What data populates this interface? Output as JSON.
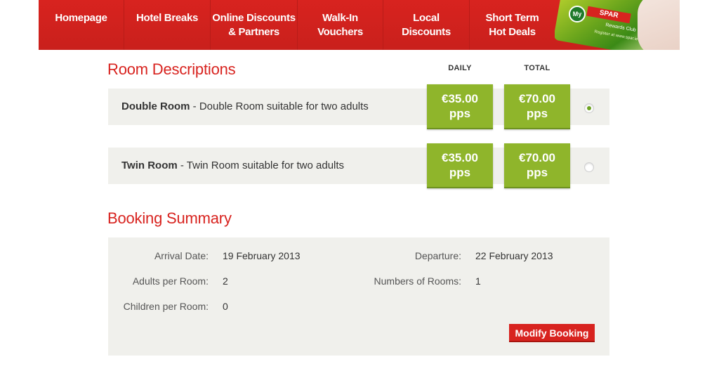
{
  "nav": {
    "items": [
      {
        "lines": [
          "Homepage"
        ]
      },
      {
        "lines": [
          "Hotel Breaks"
        ]
      },
      {
        "lines": [
          "Online Discounts",
          "& Partners"
        ]
      },
      {
        "lines": [
          "Walk-In",
          "Vouchers"
        ]
      },
      {
        "lines": [
          "Local",
          "Discounts"
        ]
      },
      {
        "lines": [
          "Short Term",
          "Hot Deals"
        ]
      }
    ],
    "card": {
      "my": "My",
      "brand": "SPAR",
      "rewards": "Rewards Club",
      "url": "Register at www.spar.ie"
    }
  },
  "rooms": {
    "heading": "Room Descriptions",
    "col_daily": "DAILY",
    "col_total": "TOTAL",
    "items": [
      {
        "name": "Double Room",
        "desc": " - Double Room suitable for two adults",
        "daily": "€35.00",
        "daily_unit": "pps",
        "total": "€70.00",
        "total_unit": "pps",
        "selected": true
      },
      {
        "name": "Twin Room",
        "desc": " - Twin Room suitable for two adults",
        "daily": "€35.00",
        "daily_unit": "pps",
        "total": "€70.00",
        "total_unit": "pps",
        "selected": false
      }
    ]
  },
  "summary": {
    "heading": "Booking Summary",
    "arrival_label": "Arrival Date:",
    "arrival_value": "19 February 2013",
    "departure_label": "Departure:",
    "departure_value": "22 February 2013",
    "adults_label": "Adults per Room:",
    "adults_value": "2",
    "rooms_label": "Numbers of Rooms:",
    "rooms_value": "1",
    "children_label": "Children per Room:",
    "children_value": "0",
    "modify_label": "Modify Booking"
  },
  "colors": {
    "brand_red": "#d8231f",
    "price_green": "#8fb52b",
    "row_bg": "#f0f0ec"
  }
}
